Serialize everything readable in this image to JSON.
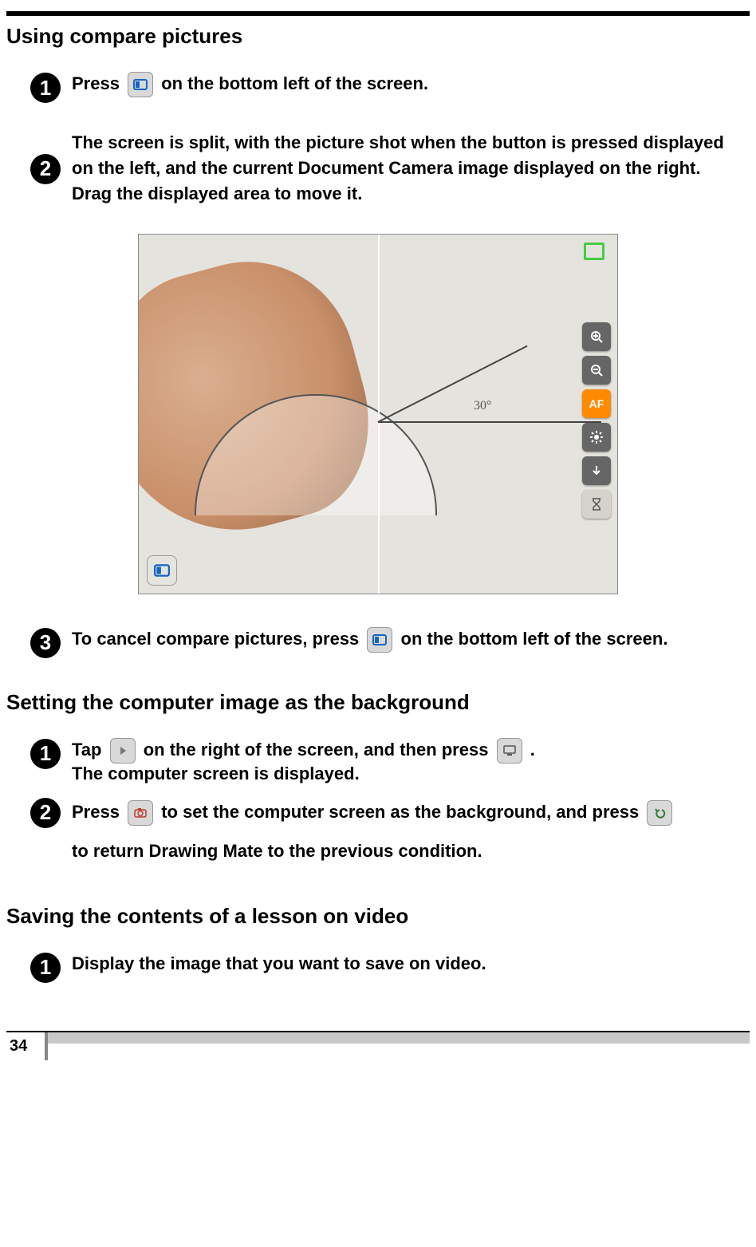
{
  "page_number": "34",
  "sections": {
    "compare": {
      "heading": "Using compare pictures",
      "steps": [
        {
          "n": "1",
          "pre": "Press ",
          "post": " on the bottom left of the screen."
        },
        {
          "n": "2",
          "text": "The screen is split, with the picture shot when the button is pressed displayed on the left, and the current Document Camera image displayed on the right. Drag the displayed area to move it."
        },
        {
          "n": "3",
          "pre": "To cancel compare pictures, press ",
          "post": "  on the bottom left of the screen."
        }
      ]
    },
    "background": {
      "heading": "Setting the computer image as the background",
      "steps": [
        {
          "n": "1",
          "pre": "Tap ",
          "mid": " on the right of the screen, and then press ",
          "post": "."
        },
        {
          "n": "2",
          "lead": "The computer screen is displayed.",
          "pre": "Press ",
          "mid": " to set the computer screen as the background, and press ",
          "tail": "to return Drawing Mate to the previous condition."
        }
      ]
    },
    "video": {
      "heading": "Saving the contents of a lesson on video",
      "steps": [
        {
          "n": "1",
          "text": "Display the image that you want to save on video."
        }
      ]
    }
  },
  "screenshot": {
    "angle_label": "30°",
    "toolbar": {
      "zoom_in": "zoom-in",
      "zoom_out": "zoom-out",
      "af": "AF",
      "brightness": "brightness",
      "down": "down",
      "timer": "timer"
    }
  }
}
